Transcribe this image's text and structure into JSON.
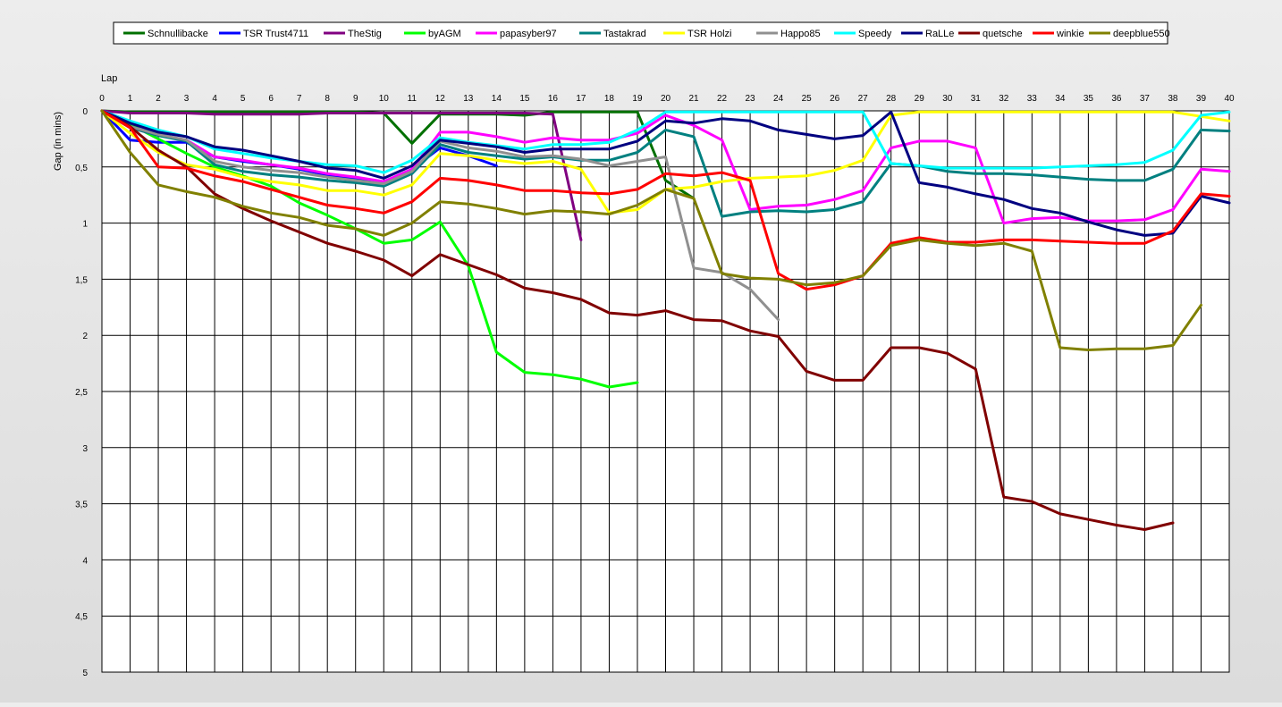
{
  "chart_data": {
    "type": "line",
    "xlabel": "Lap",
    "ylabel": "Gap (in mins)",
    "xlim": [
      0,
      40
    ],
    "ylim": [
      0,
      5
    ],
    "y_inverted": true,
    "grid": true,
    "legend_position": "top",
    "x_ticks": [
      "0",
      "1",
      "2",
      "3",
      "4",
      "5",
      "6",
      "7",
      "8",
      "9",
      "10",
      "11",
      "12",
      "13",
      "14",
      "15",
      "16",
      "17",
      "18",
      "19",
      "20",
      "21",
      "22",
      "23",
      "24",
      "25",
      "26",
      "27",
      "28",
      "29",
      "30",
      "31",
      "32",
      "33",
      "34",
      "35",
      "36",
      "37",
      "38",
      "39",
      "40"
    ],
    "y_ticks": [
      {
        "value": 0,
        "label": "0"
      },
      {
        "value": 0.5,
        "label": "0,5"
      },
      {
        "value": 1,
        "label": "1"
      },
      {
        "value": 1.5,
        "label": "1,5"
      },
      {
        "value": 2,
        "label": "2"
      },
      {
        "value": 2.5,
        "label": "2,5"
      },
      {
        "value": 3,
        "label": "3"
      },
      {
        "value": 3.5,
        "label": "3,5"
      },
      {
        "value": 4,
        "label": "4"
      },
      {
        "value": 4.5,
        "label": "4,5"
      },
      {
        "value": 5,
        "label": "5"
      }
    ],
    "series": [
      {
        "name": "Schnullibacke",
        "color": "#007000",
        "values": [
          0,
          0.01,
          0.01,
          0.01,
          0.01,
          0.01,
          0.01,
          0.01,
          0.01,
          0.01,
          0.02,
          0.29,
          0.03,
          0.03,
          0.03,
          0.04,
          0.01,
          0.01,
          0.01,
          0.01,
          0.62,
          0.78
        ]
      },
      {
        "name": "TSR Trust4711",
        "color": "#0000ff",
        "values": [
          0,
          0.26,
          0.28,
          0.28,
          0.41,
          0.45,
          0.48,
          0.52,
          0.57,
          0.6,
          0.64,
          0.52,
          0.33,
          0.4,
          0.49
        ]
      },
      {
        "name": "TheStig",
        "color": "#800080",
        "values": [
          0,
          0.02,
          0.02,
          0.02,
          0.03,
          0.03,
          0.03,
          0.03,
          0.02,
          0.02,
          0.02,
          0.02,
          0.02,
          0.02,
          0.02,
          0.02,
          0.03,
          1.15
        ]
      },
      {
        "name": "byAGM",
        "color": "#00ff00",
        "values": [
          0,
          0.12,
          0.25,
          0.38,
          0.5,
          0.58,
          0.67,
          0.82,
          0.93,
          1.05,
          1.18,
          1.15,
          0.99,
          1.38,
          2.15,
          2.33,
          2.35,
          2.39,
          2.46,
          2.42
        ]
      },
      {
        "name": "papasyber97",
        "color": "#ff00ff",
        "values": [
          0,
          0.15,
          0.22,
          0.26,
          0.41,
          0.44,
          0.48,
          0.51,
          0.56,
          0.59,
          0.63,
          0.52,
          0.19,
          0.19,
          0.23,
          0.28,
          0.24,
          0.26,
          0.26,
          0.2,
          0.04,
          0.13,
          0.26,
          0.88,
          0.85,
          0.84,
          0.79,
          0.71,
          0.33,
          0.27,
          0.27,
          0.33,
          1.0,
          0.96,
          0.95,
          0.98,
          0.98,
          0.97,
          0.88,
          0.52,
          0.54
        ]
      },
      {
        "name": "Tastakrad",
        "color": "#008080",
        "values": [
          0,
          0.15,
          0.22,
          0.27,
          0.48,
          0.54,
          0.57,
          0.59,
          0.62,
          0.64,
          0.67,
          0.56,
          0.3,
          0.37,
          0.4,
          0.43,
          0.41,
          0.44,
          0.44,
          0.37,
          0.17,
          0.23,
          0.94,
          0.9,
          0.89,
          0.9,
          0.88,
          0.81,
          0.47,
          0.49,
          0.54,
          0.56,
          0.56,
          0.57,
          0.59,
          0.61,
          0.62,
          0.62,
          0.52,
          0.17,
          0.18
        ]
      },
      {
        "name": "TSR Holzi",
        "color": "#ffff00",
        "values": [
          0,
          0.2,
          0.37,
          0.48,
          0.52,
          0.59,
          0.63,
          0.66,
          0.71,
          0.71,
          0.75,
          0.66,
          0.38,
          0.4,
          0.44,
          0.47,
          0.45,
          0.52,
          0.91,
          0.88,
          0.7,
          0.68,
          0.63,
          0.6,
          0.59,
          0.58,
          0.53,
          0.44,
          0.04,
          0.01,
          0.01,
          0.01,
          0.01,
          0.01,
          0.01,
          0.01,
          0.01,
          0.01,
          0.01,
          0.05,
          0.09
        ]
      },
      {
        "name": "Happo85",
        "color": "#909090",
        "values": [
          0,
          0.14,
          0.21,
          0.26,
          0.45,
          0.5,
          0.53,
          0.55,
          0.59,
          0.62,
          0.65,
          0.54,
          0.27,
          0.33,
          0.36,
          0.41,
          0.4,
          0.43,
          0.49,
          0.45,
          0.41,
          1.4,
          1.44,
          1.59,
          1.86
        ]
      },
      {
        "name": "Speedy",
        "color": "#00ffff",
        "values": [
          0,
          0.09,
          0.17,
          0.23,
          0.34,
          0.38,
          0.42,
          0.45,
          0.48,
          0.49,
          0.55,
          0.44,
          0.24,
          0.28,
          0.31,
          0.34,
          0.3,
          0.3,
          0.28,
          0.17,
          0.01,
          0.01,
          0.01,
          0.01,
          0.01,
          0.01,
          0.01,
          0.01,
          0.47,
          0.49,
          0.51,
          0.51,
          0.51,
          0.51,
          0.5,
          0.49,
          0.48,
          0.46,
          0.35,
          0.04,
          0.01
        ]
      },
      {
        "name": "RaLLe",
        "color": "#000080",
        "values": [
          0,
          0.11,
          0.19,
          0.23,
          0.32,
          0.35,
          0.4,
          0.45,
          0.51,
          0.53,
          0.6,
          0.49,
          0.26,
          0.29,
          0.32,
          0.37,
          0.34,
          0.34,
          0.34,
          0.27,
          0.09,
          0.11,
          0.07,
          0.09,
          0.17,
          0.21,
          0.25,
          0.22,
          0.01,
          0.64,
          0.68,
          0.74,
          0.79,
          0.87,
          0.91,
          0.99,
          1.06,
          1.11,
          1.09,
          0.76,
          0.82
        ]
      },
      {
        "name": "quetsche",
        "color": "#800000",
        "values": [
          0,
          0.14,
          0.35,
          0.5,
          0.74,
          0.87,
          0.98,
          1.08,
          1.18,
          1.25,
          1.33,
          1.47,
          1.28,
          1.37,
          1.46,
          1.58,
          1.62,
          1.68,
          1.8,
          1.82,
          1.78,
          1.86,
          1.87,
          1.96,
          2.01,
          2.32,
          2.4,
          2.4,
          2.11,
          2.11,
          2.16,
          2.3,
          3.44,
          3.48,
          3.59,
          3.64,
          3.69,
          3.73,
          3.67
        ]
      },
      {
        "name": "winkie",
        "color": "#ff0000",
        "values": [
          0,
          0.15,
          0.5,
          0.51,
          0.58,
          0.63,
          0.7,
          0.77,
          0.84,
          0.87,
          0.91,
          0.81,
          0.6,
          0.62,
          0.66,
          0.71,
          0.71,
          0.73,
          0.74,
          0.7,
          0.56,
          0.58,
          0.55,
          0.62,
          1.45,
          1.59,
          1.55,
          1.47,
          1.18,
          1.13,
          1.17,
          1.17,
          1.15,
          1.15,
          1.16,
          1.17,
          1.18,
          1.18,
          1.07,
          0.74,
          0.76
        ]
      },
      {
        "name": "deepblue550",
        "color": "#808000",
        "values": [
          0,
          0.37,
          0.66,
          0.72,
          0.77,
          0.85,
          0.91,
          0.95,
          1.02,
          1.05,
          1.11,
          1.0,
          0.81,
          0.83,
          0.87,
          0.92,
          0.89,
          0.9,
          0.92,
          0.84,
          0.7,
          0.78,
          1.45,
          1.49,
          1.5,
          1.55,
          1.53,
          1.47,
          1.2,
          1.15,
          1.18,
          1.2,
          1.18,
          1.25,
          2.11,
          2.13,
          2.12,
          2.12,
          2.09,
          1.73
        ]
      }
    ]
  }
}
